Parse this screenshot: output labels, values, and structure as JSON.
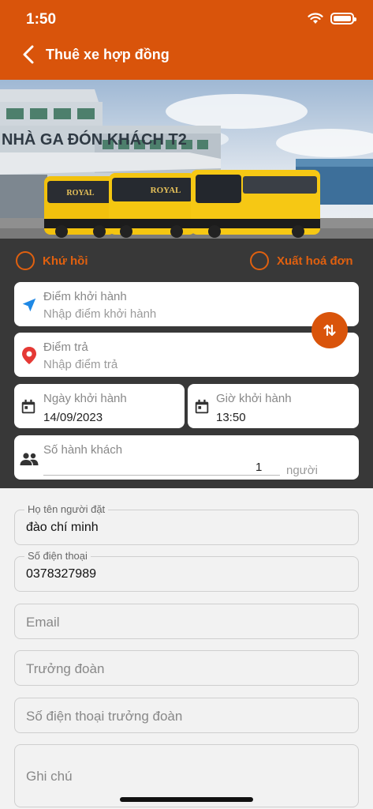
{
  "status": {
    "time": "1:50"
  },
  "header": {
    "title": "Thuê xe hợp đồng"
  },
  "banner": {
    "sign_text": "NHÀ GA ĐÓN KHÁCH T2",
    "bus_brand": "ROYAL"
  },
  "options": {
    "round_trip": "Khứ hồi",
    "invoice": "Xuất hoá đơn"
  },
  "trip": {
    "departure_label": "Điểm khởi hành",
    "departure_placeholder": "Nhập điểm khởi hành",
    "dropoff_label": "Điểm trả",
    "dropoff_placeholder": "Nhập điểm trả",
    "date_label": "Ngày khởi hành",
    "date_value": "14/09/2023",
    "time_label": "Giờ khởi hành",
    "time_value": "13:50",
    "passengers_label": "Số hành khách",
    "passengers_value": "1",
    "passengers_unit": "người"
  },
  "contact": {
    "name_label": "Họ tên người đặt",
    "name_value": "đào chí minh",
    "phone_label": "Số điện thoại",
    "phone_value": "0378327989",
    "email_placeholder": "Email",
    "leader_placeholder": "Trưởng đoàn",
    "leader_phone_placeholder": "Số điện thoại trưởng đoàn",
    "note_placeholder": "Ghi chú"
  },
  "colors": {
    "brand": "#d9540b",
    "panel": "#383838",
    "location_blue": "#1e88e5",
    "pin_red": "#e53935"
  }
}
